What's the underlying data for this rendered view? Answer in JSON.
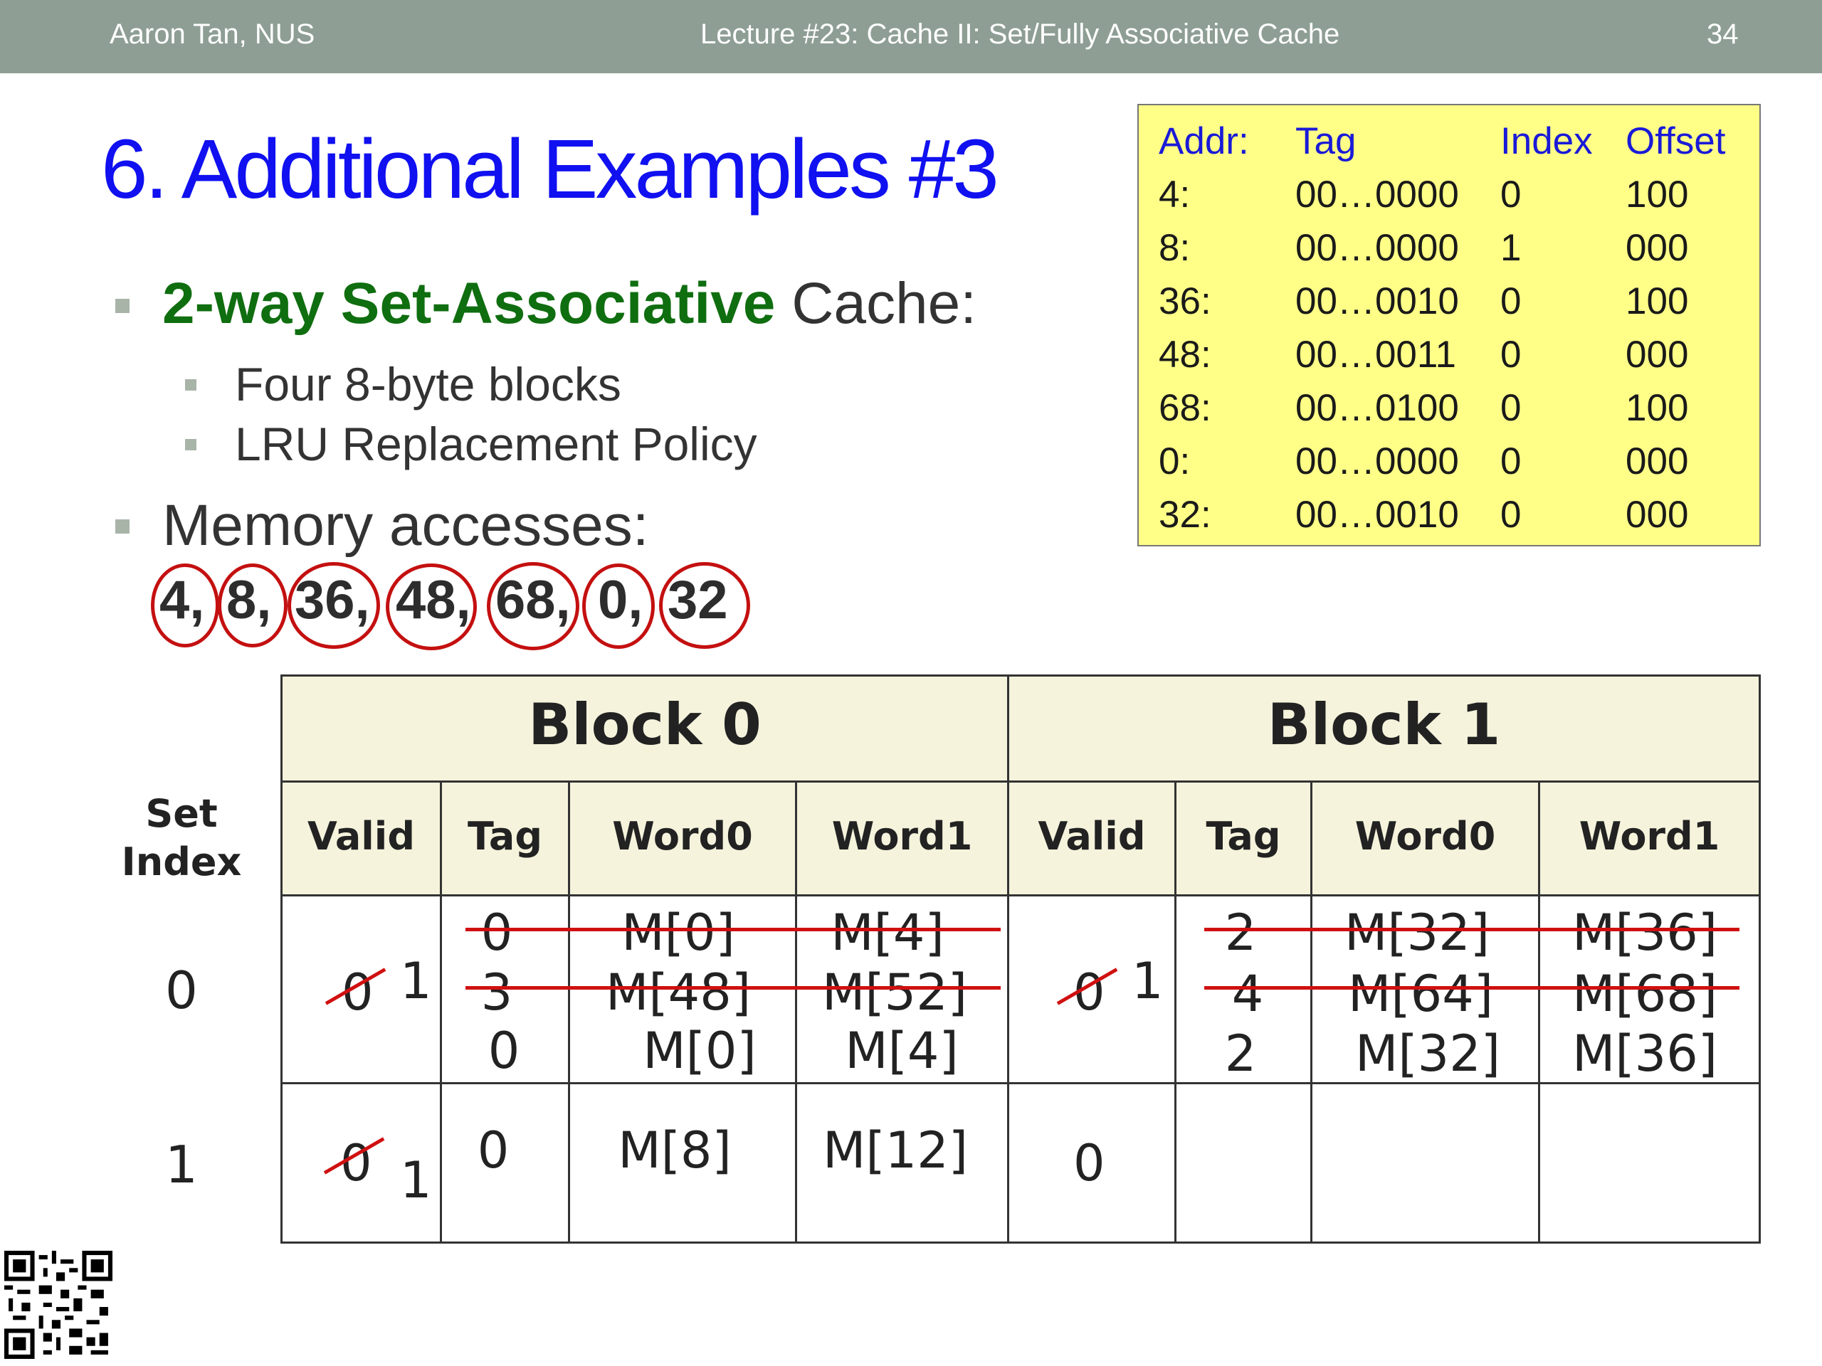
{
  "header": {
    "author": "Aaron Tan, NUS",
    "lecture": "Lecture #23: Cache II: Set/Fully Associative Cache",
    "page": "34"
  },
  "title": "6. Additional Examples #3",
  "bullets": {
    "cache_type_bold": "2-way Set-Associative",
    "cache_type_rest": " Cache:",
    "sub1": "Four 8-byte blocks",
    "sub2": "LRU Replacement Policy",
    "accesses_label": "Memory accesses:",
    "accesses": [
      "4,",
      "8,",
      "36,",
      "48,",
      "68,",
      "0,",
      "32"
    ]
  },
  "addr_table": {
    "headers": [
      "Addr:",
      "Tag",
      "Index",
      "Offset"
    ],
    "rows": [
      [
        "4:",
        "00…0000",
        "0",
        "100"
      ],
      [
        "8:",
        "00…0000",
        "1",
        "000"
      ],
      [
        "36:",
        "00…0010",
        "0",
        "100"
      ],
      [
        "48:",
        "00…0011",
        "0",
        "000"
      ],
      [
        "68:",
        "00…0100",
        "0",
        "100"
      ],
      [
        "0:",
        "00…0000",
        "0",
        "000"
      ],
      [
        "32:",
        "00…0010",
        "0",
        "000"
      ]
    ]
  },
  "cache": {
    "block0": "Block 0",
    "block1": "Block 1",
    "set_index": [
      "Set",
      "Index"
    ],
    "columns": [
      "Valid",
      "Tag",
      "Word0",
      "Word1",
      "Valid",
      "Tag",
      "Word0",
      "Word1"
    ],
    "set0": {
      "index": "0",
      "b0_valid_old": "0",
      "b0_valid_new": "1",
      "b0_tags": [
        "0",
        "3",
        "0"
      ],
      "b0_word0": [
        "M[0]",
        "M[48]",
        "M[0]"
      ],
      "b0_word1": [
        "M[4]",
        "M[52]",
        "M[4]"
      ],
      "b1_valid_old": "0",
      "b1_valid_new": "1",
      "b1_tags": [
        "2",
        "4",
        "2"
      ],
      "b1_word0": [
        "M[32]",
        "M[64]",
        "M[32]"
      ],
      "b1_word1": [
        "M[36]",
        "M[68]",
        "M[36]"
      ]
    },
    "set1": {
      "index": "1",
      "b0_valid_old": "0",
      "b0_valid_new": "1",
      "b0_tag": "0",
      "b0_word0": "M[8]",
      "b0_word1": "M[12]",
      "b1_valid": "0"
    }
  },
  "colors": {
    "topbar": "#8e9e94",
    "title": "#1010f0",
    "accent_green": "#0f6e0f",
    "strike_red": "#d01010",
    "addr_box": "#ffff88"
  }
}
